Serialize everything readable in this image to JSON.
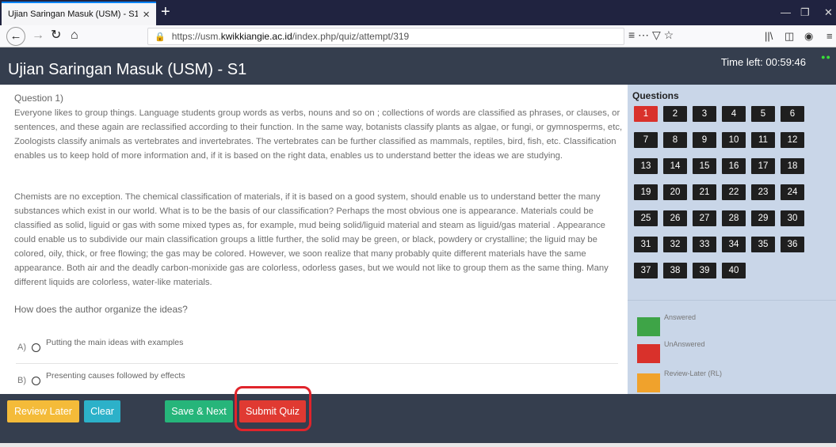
{
  "browser": {
    "tab_title": "Ujian Saringan Masuk (USM) - S1",
    "tab_close": "×",
    "new_tab": "+",
    "url_prefix": "https://usm.",
    "url_domain": "kwikkiangie.ac.id",
    "url_path": "/index.php/quiz/attempt/319",
    "page_actions": "≡   ⋯ ▽ ☆"
  },
  "header": {
    "title": "Ujian Saringan Masuk (USM) - S1",
    "time_left": "Time left: 00:59:46"
  },
  "question": {
    "number_label": "Question 1)",
    "paragraph1": "Everyone likes to group things. Language students group words as verbs, nouns and so on ; collections of words are classified as phrases, or clauses, or sentences, and these again are reclassified according to their function. In the same way, botanists classify plants as algae, or fungi, or gymnosperms, etc, Zoologists classify animals as vertebrates and invertebrates. The vertebrates can be further classified as mammals, reptiles, bird, fish, etc. Classification enables us to keep hold of more information and, if it is based on the right data, enables us to understand better the ideas we are studying.",
    "paragraph2": "Chemists are no exception. The chemical classification of materials, if it is based on a good system, should enable us to understand better the many substances which exist in our world. What is to be the basis of our classification? Perhaps the most obvious one is appearance. Materials could be classified as solid, liguid or gas with some mixed types as, for example, mud being solid/liguid material and steam as liguid/gas material . Appearance could enable us to subdivide our main classification groups a little further, the solid may be green, or black, powdery or crystalline; the liguid may be colored, oily, thick, or free flowing; the gas may be colored. However, we soon realize that many probably quite different materials have the same appearance. Both air and the deadly carbon-monixide gas are colorless, odorless gases, but we would not like to group them as the same thing. Many different liquids are colorless, water-like materials.",
    "prompt": "How does the author organize the ideas?",
    "options": [
      {
        "letter": "A)",
        "text": "Putting the main ideas with examples"
      },
      {
        "letter": "B)",
        "text": "Presenting causes followed by effects"
      }
    ]
  },
  "panel": {
    "title": "Questions",
    "current": 1,
    "numbers": [
      "1",
      "2",
      "3",
      "4",
      "5",
      "6",
      "7",
      "8",
      "9",
      "10",
      "11",
      "12",
      "13",
      "14",
      "15",
      "16",
      "17",
      "18",
      "19",
      "20",
      "21",
      "22",
      "23",
      "24",
      "25",
      "26",
      "27",
      "28",
      "29",
      "30",
      "31",
      "32",
      "33",
      "34",
      "35",
      "36",
      "37",
      "38",
      "39",
      "40"
    ],
    "legend": [
      {
        "label": "Answered",
        "color": "#3ea447"
      },
      {
        "label": "UnAnswered",
        "color": "#d9312b"
      },
      {
        "label": "Review-Later (RL)",
        "color": "#f0a22c"
      }
    ]
  },
  "footer": {
    "review_later": "Review Later",
    "clear": "Clear",
    "save_next": "Save & Next",
    "submit": "Submit Quiz"
  }
}
